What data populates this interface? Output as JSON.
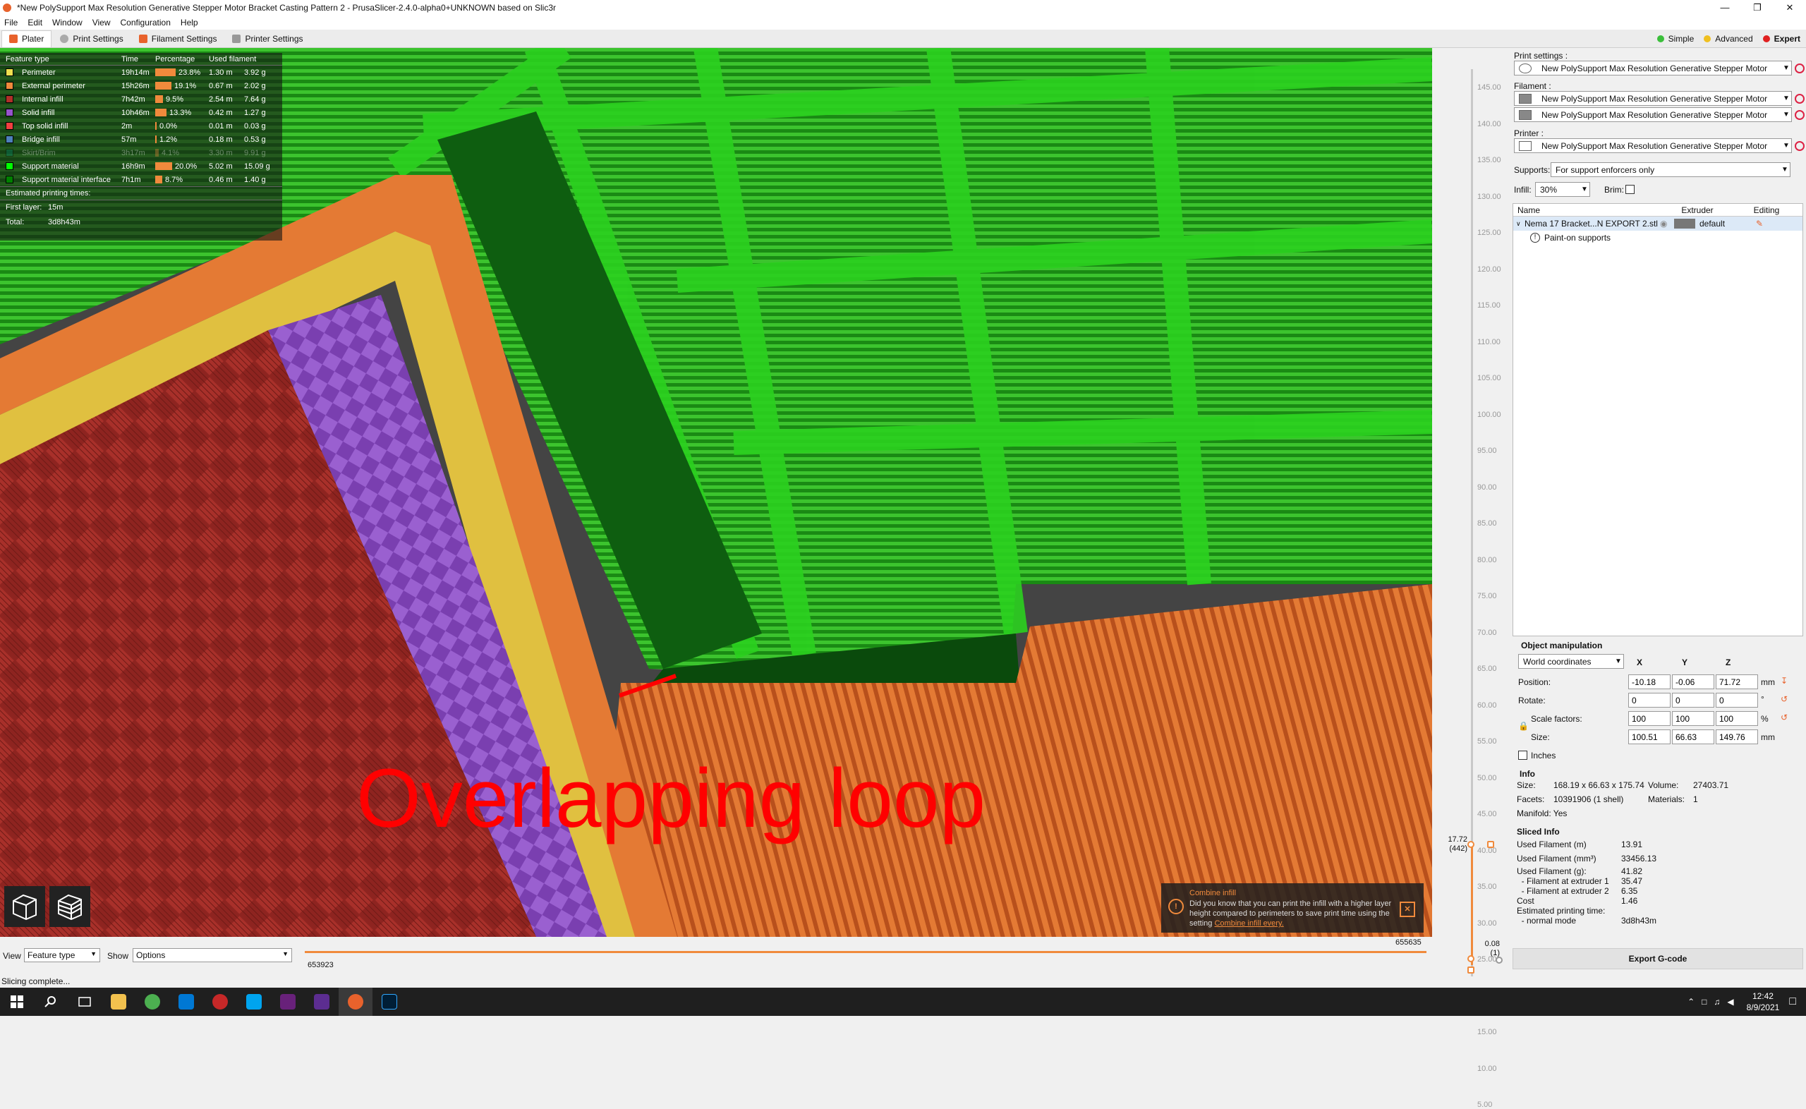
{
  "window": {
    "title": "*New PolySupport Max Resolution Generative Stepper Motor Bracket Casting Pattern 2 - PrusaSlicer-2.4.0-alpha0+UNKNOWN based on Slic3r"
  },
  "menu": [
    "File",
    "Edit",
    "Window",
    "View",
    "Configuration",
    "Help"
  ],
  "tabs": [
    "Plater",
    "Print Settings",
    "Filament Settings",
    "Printer Settings"
  ],
  "modes": [
    {
      "label": "Simple",
      "color": "#3bbf3b"
    },
    {
      "label": "Advanced",
      "color": "#f0c020"
    },
    {
      "label": "Expert",
      "color": "#e02020"
    }
  ],
  "legend": {
    "headers": [
      "Feature type",
      "Time",
      "Percentage",
      "Used filament"
    ],
    "rows": [
      {
        "name": "Perimeter",
        "color": "#f0e050",
        "time": "19h14m",
        "pct": "23.8%",
        "len": "1.30 m",
        "g": "3.92 g",
        "frac": 0.238
      },
      {
        "name": "External perimeter",
        "color": "#f08a3c",
        "time": "15h26m",
        "pct": "19.1%",
        "len": "0.67 m",
        "g": "2.02 g",
        "frac": 0.191
      },
      {
        "name": "Internal infill",
        "color": "#b03029",
        "time": "7h42m",
        "pct": "9.5%",
        "len": "2.54 m",
        "g": "7.64 g",
        "frac": 0.095
      },
      {
        "name": "Solid infill",
        "color": "#9654cc",
        "time": "10h46m",
        "pct": "13.3%",
        "len": "0.42 m",
        "g": "1.27 g",
        "frac": 0.133
      },
      {
        "name": "Top solid infill",
        "color": "#f04040",
        "time": "2m",
        "pct": "0.0%",
        "len": "0.01 m",
        "g": "0.03 g",
        "frac": 0.0
      },
      {
        "name": "Bridge infill",
        "color": "#4d80ba",
        "time": "57m",
        "pct": "1.2%",
        "len": "0.18 m",
        "g": "0.53 g",
        "frac": 0.012
      },
      {
        "name": "Skirt/Brim",
        "color": "#00876e",
        "time": "3h17m",
        "pct": "4.1%",
        "len": "3.30 m",
        "g": "9.91 g",
        "frac": 0.041,
        "dim": true
      },
      {
        "name": "Support material",
        "color": "#00ff00",
        "time": "16h9m",
        "pct": "20.0%",
        "len": "5.02 m",
        "g": "15.09 g",
        "frac": 0.2
      },
      {
        "name": "Support material interface",
        "color": "#008000",
        "time": "7h1m",
        "pct": "8.7%",
        "len": "0.46 m",
        "g": "1.40 g",
        "frac": 0.087
      }
    ],
    "est_label": "Estimated printing times:",
    "first_layer_label": "First layer:",
    "first_layer": "15m",
    "total_label": "Total:",
    "total": "3d8h43m"
  },
  "annotation": "Overlapping loop",
  "tip": {
    "title": "Combine infill",
    "body": "Did you know that you can print the infill with a higher layer height compared to perimeters to save print time using the setting",
    "link": "Combine infill every."
  },
  "vslider": {
    "ticks": [
      "145.00",
      "140.00",
      "135.00",
      "130.00",
      "125.00",
      "120.00",
      "115.00",
      "110.00",
      "105.00",
      "100.00",
      "95.00",
      "90.00",
      "85.00",
      "80.00",
      "75.00",
      "70.00",
      "65.00",
      "60.00",
      "55.00",
      "50.00",
      "45.00",
      "40.00",
      "35.00",
      "30.00",
      "25.00",
      "20.00",
      "15.00",
      "10.00",
      "5.00"
    ],
    "upper": "17.72",
    "upper_layer": "(442)",
    "lower": "0.08",
    "lower_layer": "(1)"
  },
  "bottom": {
    "view_label": "View",
    "view_value": "Feature type",
    "show_label": "Show",
    "show_value": "Options",
    "h_left": "653923",
    "h_right": "655635"
  },
  "status": "Slicing complete...",
  "side": {
    "print_label": "Print settings :",
    "print_value": "New PolySupport Max Resolution Generative Stepper Motor",
    "filament_label": "Filament :",
    "filament1": "New PolySupport Max Resolution Generative Stepper Motor",
    "filament2": "New PolySupport Max Resolution Generative Stepper Motor",
    "printer_label": "Printer :",
    "printer_value": "New PolySupport Max Resolution Generative Stepper Motor",
    "supports_label": "Supports:",
    "supports_value": "For support enforcers only",
    "infill_label": "Infill:",
    "infill_value": "30%",
    "brim_label": "Brim:",
    "list_headers": [
      "Name",
      "Extruder",
      "Editing"
    ],
    "object_name": "Nema 17 Bracket...N EXPORT 2.stl",
    "object_extruder": "default",
    "child": "Paint-on supports"
  },
  "manip": {
    "title": "Object manipulation",
    "coords": "World coordinates",
    "axes": [
      "X",
      "Y",
      "Z"
    ],
    "position_label": "Position:",
    "position": [
      "-10.18",
      "-0.06",
      "71.72"
    ],
    "pos_unit": "mm",
    "rotate_label": "Rotate:",
    "rotate": [
      "0",
      "0",
      "0"
    ],
    "rot_unit": "°",
    "scale_label": "Scale factors:",
    "scale": [
      "100",
      "100",
      "100"
    ],
    "scale_unit": "%",
    "size_label": "Size:",
    "size": [
      "100.51",
      "66.63",
      "149.76"
    ],
    "size_unit": "mm",
    "inches": "Inches"
  },
  "info": {
    "title": "Info",
    "size_label": "Size:",
    "size": "168.19 x 66.63 x 175.74",
    "volume_label": "Volume:",
    "volume": "27403.71",
    "facets_label": "Facets:",
    "facets": "10391906 (1 shell)",
    "materials_label": "Materials:",
    "materials": "1",
    "manifold": "Manifold: Yes"
  },
  "sliced": {
    "title": "Sliced Info",
    "rows": [
      {
        "k": "Used Filament (m)",
        "v": "13.91"
      },
      {
        "k": "Used Filament (mm³)",
        "v": "33456.13"
      },
      {
        "k": "Used Filament (g):",
        "v": "41.82"
      },
      {
        "k": "  - Filament at extruder 1",
        "v": "35.47"
      },
      {
        "k": "  - Filament at extruder 2",
        "v": "6.35"
      },
      {
        "k": "Cost",
        "v": "1.46"
      },
      {
        "k": "Estimated printing time:",
        "v": ""
      },
      {
        "k": "  - normal mode",
        "v": "3d8h43m"
      }
    ]
  },
  "export": "Export G-code",
  "taskbar": {
    "time": "12:42",
    "date": "8/9/2021",
    "apps": [
      "#1e1e1e",
      "#1e1e1e",
      "#1e1e1e",
      "#f2c14e",
      "#4caf50",
      "#0078d4",
      "#c62828",
      "#00a4ef",
      "#68217a",
      "#5c2d91",
      "#e8622c",
      "#31a8ff"
    ]
  }
}
